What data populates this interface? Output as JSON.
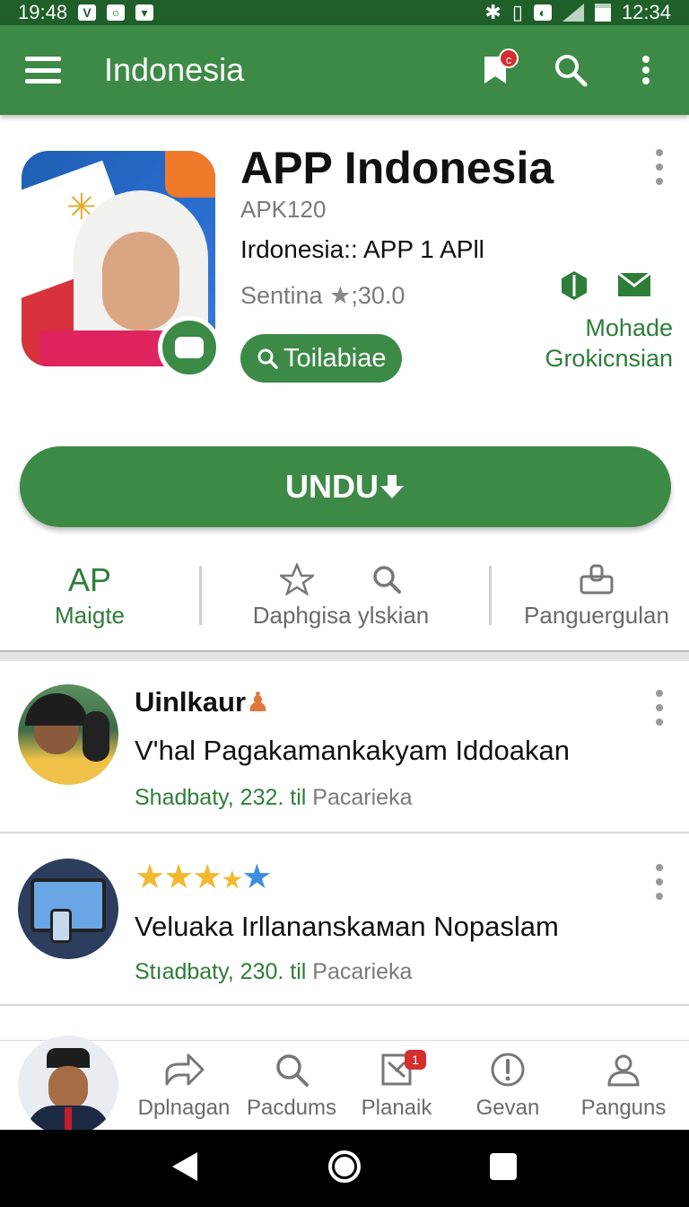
{
  "status_bar": {
    "time_left": "19:48",
    "time_right": "12:34"
  },
  "app_bar": {
    "title": "Indonesia",
    "notification_badge": "c"
  },
  "app": {
    "title": "APP Indonesia",
    "developer": "APK120",
    "subtitle": "Irdonesia:: APP 1 APll",
    "rating_label": "Sentina",
    "rating_value": ";30.0",
    "pill_button": "Toilabiae",
    "side_label_line1": "Mohade",
    "side_label_line2": "Grokicnsian",
    "download_button": "UNDU"
  },
  "tabs": [
    {
      "icon_text": "AP",
      "label": "Maigte"
    },
    {
      "label": "Daphgisa ylskian"
    },
    {
      "label": "Panguergulan"
    }
  ],
  "list": [
    {
      "title": "Uinlkaur",
      "text": "V'hal Pagakamankakyam Iddoakan",
      "meta_green": "Shadbaty, 232. til",
      "meta_grey": "Pacarieka"
    },
    {
      "rating": 4.5,
      "text": "Veluaka Irllananskaмan Nopaslam",
      "meta_green": "Stıadbaty, 230. til",
      "meta_grey": "Pacarieka"
    }
  ],
  "bottom_nav": [
    {
      "label": "Dplnagan"
    },
    {
      "label": "Pacdums"
    },
    {
      "label": "Planaik",
      "badge": "1"
    },
    {
      "label": "Gevan"
    },
    {
      "label": "Panguns"
    }
  ],
  "colors": {
    "primary": "#3c8a46",
    "status_bar": "#1f5f2a",
    "accent_red": "#d32f2f",
    "star_yellow": "#f2b830",
    "star_blue": "#3b8fe0"
  }
}
